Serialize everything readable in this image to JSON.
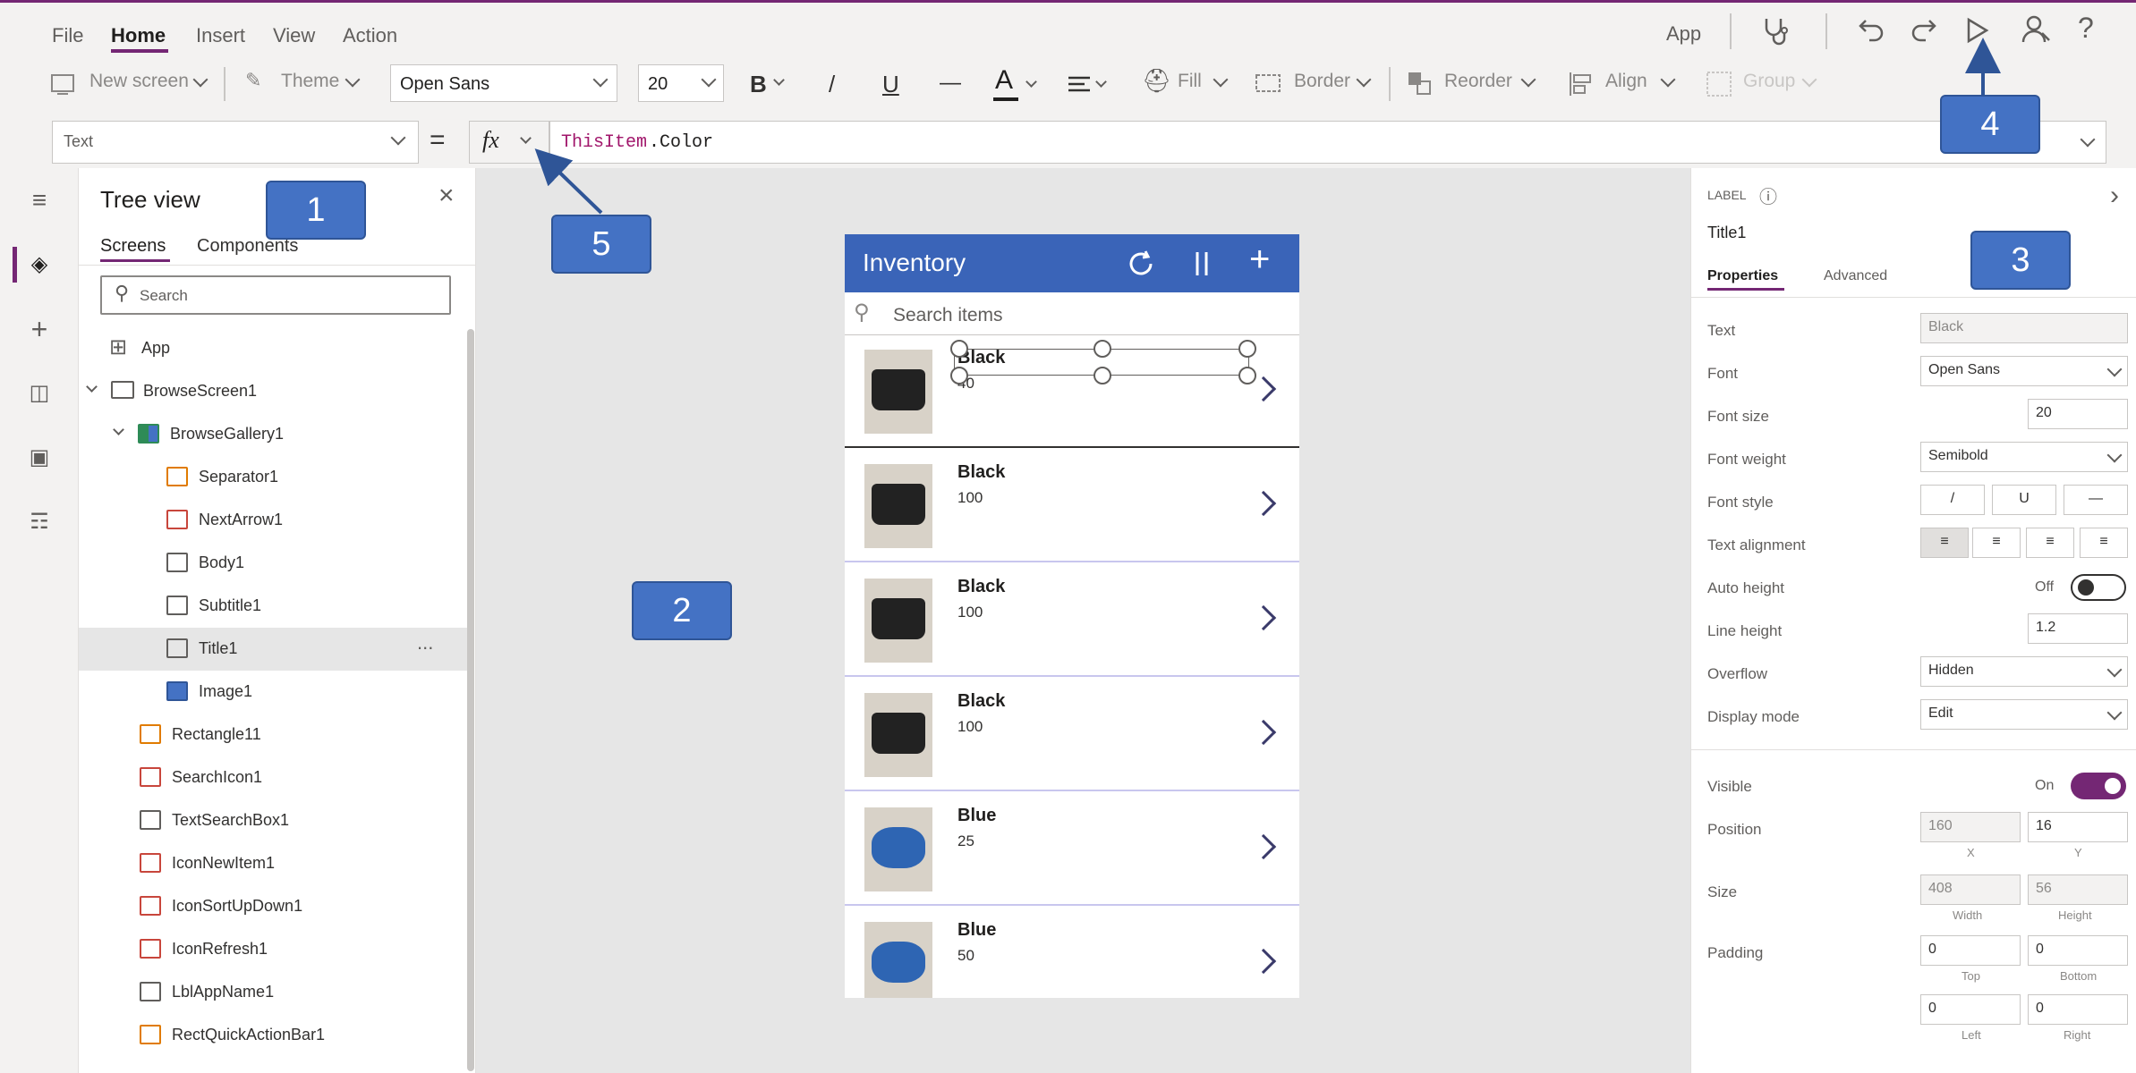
{
  "menu": {
    "items": [
      "File",
      "Home",
      "Insert",
      "View",
      "Action"
    ],
    "active": "Home",
    "app_label": "App"
  },
  "ribbon": {
    "new_screen": "New screen",
    "theme": "Theme",
    "font": "Open Sans",
    "font_size": "20",
    "bold": "B",
    "italic": "/",
    "underline": "U",
    "strike": "—",
    "font_color": "A",
    "fill": "Fill",
    "border": "Border",
    "reorder": "Reorder",
    "align": "Align",
    "group": "Group"
  },
  "formula": {
    "property": "Text",
    "equals": "=",
    "fx": "fx",
    "keyword": "ThisItem",
    "rest": ".Color"
  },
  "tree": {
    "title": "Tree view",
    "tabs": [
      "Screens",
      "Components"
    ],
    "search_placeholder": "Search",
    "items": [
      "App",
      "BrowseScreen1",
      "BrowseGallery1",
      "Separator1",
      "NextArrow1",
      "Body1",
      "Subtitle1",
      "Title1",
      "Image1",
      "Rectangle11",
      "SearchIcon1",
      "TextSearchBox1",
      "IconNewItem1",
      "IconSortUpDown1",
      "IconRefresh1",
      "LblAppName1",
      "RectQuickActionBar1"
    ],
    "more": "..."
  },
  "phone": {
    "title": "Inventory",
    "search_placeholder": "Search items",
    "rows": [
      {
        "title": "Black",
        "sub": "40",
        "kind": "black"
      },
      {
        "title": "Black",
        "sub": "100",
        "kind": "black"
      },
      {
        "title": "Black",
        "sub": "100",
        "kind": "black"
      },
      {
        "title": "Black",
        "sub": "100",
        "kind": "black"
      },
      {
        "title": "Blue",
        "sub": "25",
        "kind": "blue"
      },
      {
        "title": "Blue",
        "sub": "50",
        "kind": "blue"
      }
    ]
  },
  "callouts": [
    "1",
    "2",
    "3",
    "4",
    "5"
  ],
  "props": {
    "type": "LABEL",
    "name": "Title1",
    "tabs": [
      "Properties",
      "Advanced"
    ],
    "rows": {
      "text": {
        "label": "Text",
        "value": "Black"
      },
      "font": {
        "label": "Font",
        "value": "Open Sans"
      },
      "font_size": {
        "label": "Font size",
        "value": "20"
      },
      "font_weight": {
        "label": "Font weight",
        "value": "Semibold"
      },
      "font_style": {
        "label": "Font style"
      },
      "text_alignment": {
        "label": "Text alignment"
      },
      "auto_height": {
        "label": "Auto height",
        "value": "Off"
      },
      "line_height": {
        "label": "Line height",
        "value": "1.2"
      },
      "overflow": {
        "label": "Overflow",
        "value": "Hidden"
      },
      "display_mode": {
        "label": "Display mode",
        "value": "Edit"
      },
      "visible": {
        "label": "Visible",
        "value": "On"
      },
      "position": {
        "label": "Position",
        "x": "160",
        "y": "16",
        "x_cap": "X",
        "y_cap": "Y"
      },
      "size": {
        "label": "Size",
        "w": "408",
        "h": "56",
        "w_cap": "Width",
        "h_cap": "Height"
      },
      "padding": {
        "label": "Padding",
        "top": "0",
        "bottom": "0",
        "left": "0",
        "right": "0",
        "top_cap": "Top",
        "bottom_cap": "Bottom",
        "left_cap": "Left",
        "right_cap": "Right"
      }
    }
  },
  "colors": {
    "accent": "#742774",
    "phone_header": "#3a64b8",
    "callout": "#4472c4"
  }
}
